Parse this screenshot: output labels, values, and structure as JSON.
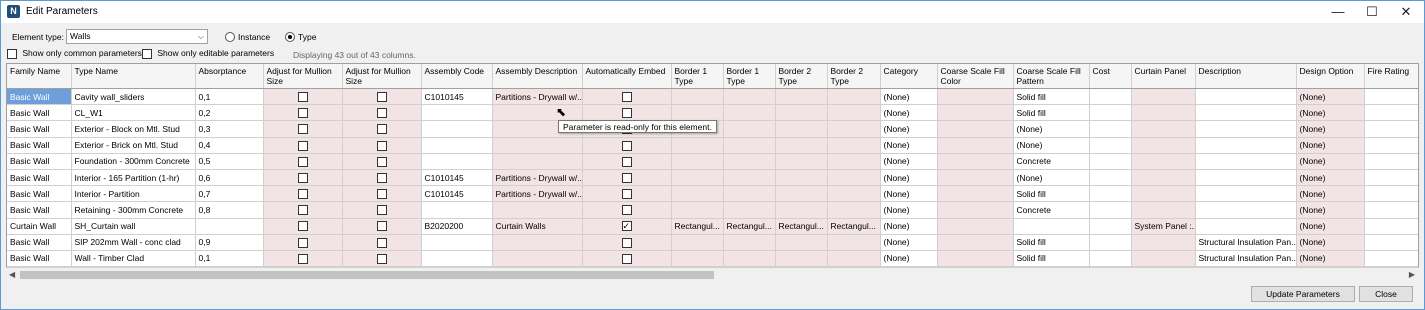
{
  "window": {
    "title": "Edit Parameters",
    "minimize": "—",
    "maximize": "☐",
    "close": "✕",
    "app_icon": "N"
  },
  "filters": {
    "element_type_label": "Element type:",
    "element_type_value": "Walls",
    "instance_label": "Instance",
    "type_label": "Type",
    "selected_mode": "Type",
    "common_only_label": "Show only common parameters",
    "editable_only_label": "Show only editable parameters",
    "display_info": "Displaying 43 out of 43 columns."
  },
  "grid": {
    "columns": [
      "Family Name",
      "Type Name",
      "Absorptance",
      "Adjust for Mullion Size",
      "Adjust for Mullion Size",
      "Assembly Code",
      "Assembly Description",
      "Automatically Embed",
      "Border 1 Type",
      "Border 1 Type",
      "Border 2 Type",
      "Border 2 Type",
      "Category",
      "Coarse Scale Fill Color",
      "Coarse Scale Fill Pattern",
      "Cost",
      "Curtain Panel",
      "Description",
      "Design Option",
      "Fire Rating"
    ],
    "rows": [
      [
        "Basic Wall",
        "Cavity wall_sliders",
        "0,1",
        false,
        false,
        "C1010145",
        "Partitions - Drywall w/...",
        false,
        "",
        "",
        "",
        "",
        "(None)",
        "",
        "Solid fill",
        "",
        "",
        "",
        "(None)",
        ""
      ],
      [
        "Basic Wall",
        "CL_W1",
        "0,2",
        false,
        false,
        "",
        "",
        false,
        "",
        "",
        "",
        "",
        "(None)",
        "",
        "Solid fill",
        "",
        "",
        "",
        "(None)",
        ""
      ],
      [
        "Basic Wall",
        "Exterior - Block on Mtl. Stud",
        "0,3",
        false,
        false,
        "",
        "",
        false,
        "",
        "",
        "",
        "",
        "(None)",
        "",
        "(None)",
        "",
        "",
        "",
        "(None)",
        ""
      ],
      [
        "Basic Wall",
        "Exterior - Brick on Mtl. Stud",
        "0,4",
        false,
        false,
        "",
        "",
        false,
        "",
        "",
        "",
        "",
        "(None)",
        "",
        "(None)",
        "",
        "",
        "",
        "(None)",
        ""
      ],
      [
        "Basic Wall",
        "Foundation - 300mm Concrete",
        "0,5",
        false,
        false,
        "",
        "",
        false,
        "",
        "",
        "",
        "",
        "(None)",
        "",
        "Concrete",
        "",
        "",
        "",
        "(None)",
        ""
      ],
      [
        "Basic Wall",
        "Interior - 165 Partition (1-hr)",
        "0,6",
        false,
        false,
        "C1010145",
        "Partitions - Drywall w/...",
        false,
        "",
        "",
        "",
        "",
        "(None)",
        "",
        "(None)",
        "",
        "",
        "",
        "(None)",
        ""
      ],
      [
        "Basic Wall",
        "Interior - Partition",
        "0,7",
        false,
        false,
        "C1010145",
        "Partitions - Drywall w/...",
        false,
        "",
        "",
        "",
        "",
        "(None)",
        "",
        "Solid fill",
        "",
        "",
        "",
        "(None)",
        ""
      ],
      [
        "Basic Wall",
        "Retaining - 300mm Concrete",
        "0,8",
        false,
        false,
        "",
        "",
        false,
        "",
        "",
        "",
        "",
        "(None)",
        "",
        "Concrete",
        "",
        "",
        "",
        "(None)",
        ""
      ],
      [
        "Curtain Wall",
        "SH_Curtain wall",
        "",
        false,
        false,
        "B2020200",
        "Curtain Walls",
        true,
        "Rectangul...",
        "Rectangul...",
        "Rectangul...",
        "Rectangul...",
        "(None)",
        "",
        "",
        "",
        "System Panel :...",
        "",
        "(None)",
        ""
      ],
      [
        "Basic Wall",
        "SIP 202mm Wall - conc clad",
        "0,9",
        false,
        false,
        "",
        "",
        false,
        "",
        "",
        "",
        "",
        "(None)",
        "",
        "Solid fill",
        "",
        "",
        "Structural Insulation Pan...",
        "(None)",
        ""
      ],
      [
        "Basic Wall",
        "Wall - Timber Clad",
        "0,1",
        false,
        false,
        "",
        "",
        false,
        "",
        "",
        "",
        "",
        "(None)",
        "",
        "Solid fill",
        "",
        "",
        "Structural Insulation Pan...",
        "(None)",
        ""
      ]
    ],
    "readonly_columns": [
      3,
      4,
      6,
      7,
      8,
      9,
      10,
      11,
      13,
      16,
      18
    ],
    "selected_cell": [
      0,
      0
    ]
  },
  "tooltip": "Parameter is read-only for this element.",
  "actions": {
    "update_label": "Update Parameters",
    "close_label": "Close"
  },
  "colors": {
    "readonly_cell": "#f2e4e4",
    "selected_cell": "#6e9fdb",
    "border_accent": "#5a9bd5"
  }
}
